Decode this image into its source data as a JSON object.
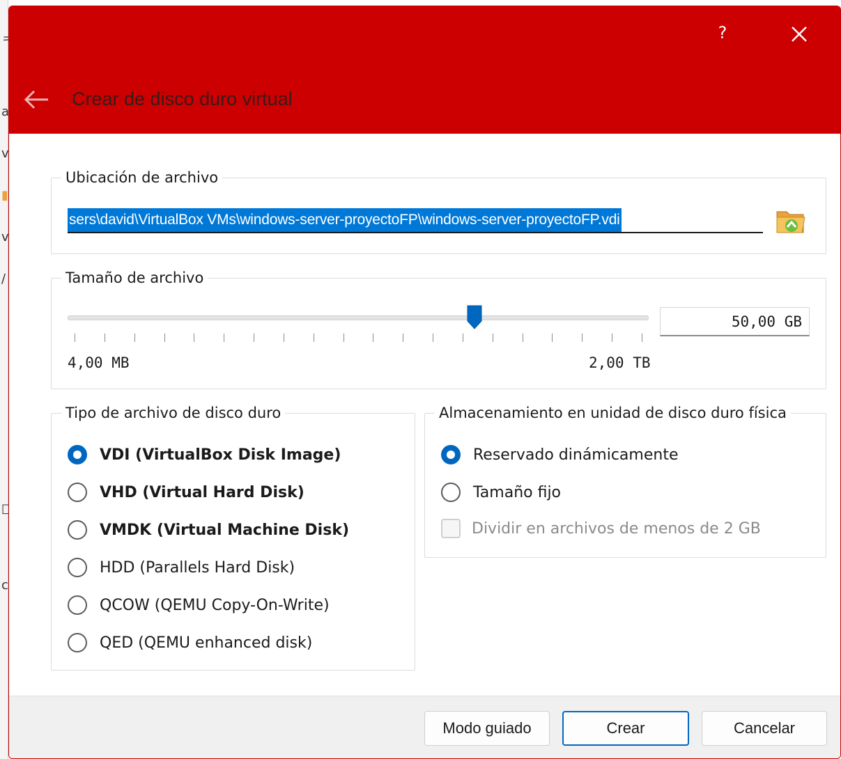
{
  "window": {
    "title": "Crear de disco duro virtual",
    "help_label": "?",
    "accent": "#cc0000"
  },
  "icons": {
    "close": "close-icon",
    "back": "back-arrow-icon",
    "folder": "folder-open-icon"
  },
  "location": {
    "legend": "Ubicación de archivo",
    "path": "sers\\david\\VirtualBox VMs\\windows-server-proyectoFP\\windows-server-proyectoFP.vdi"
  },
  "size": {
    "legend": "Tamaño de archivo",
    "value": "50,00 GB",
    "min_label": "4,00 MB",
    "max_label": "2,00 TB",
    "slider_fraction": 0.7
  },
  "disk_type": {
    "legend": "Tipo de archivo de disco duro",
    "options": [
      {
        "label": "VDI (VirtualBox Disk Image)",
        "checked": true
      },
      {
        "label": "VHD (Virtual Hard Disk)",
        "checked": false
      },
      {
        "label": "VMDK (Virtual Machine Disk)",
        "checked": false
      },
      {
        "label": "HDD (Parallels Hard Disk)",
        "checked": false
      },
      {
        "label": "QCOW (QEMU Copy-On-Write)",
        "checked": false
      },
      {
        "label": "QED (QEMU enhanced disk)",
        "checked": false
      }
    ]
  },
  "storage": {
    "legend": "Almacenamiento en unidad de disco duro física",
    "options": [
      {
        "label": "Reservado dinámicamente",
        "checked": true
      },
      {
        "label": "Tamaño fijo",
        "checked": false
      }
    ],
    "split_label": "Dividir en archivos de menos de 2 GB"
  },
  "buttons": {
    "guided": "Modo guiado",
    "create": "Crear",
    "cancel": "Cancelar"
  }
}
